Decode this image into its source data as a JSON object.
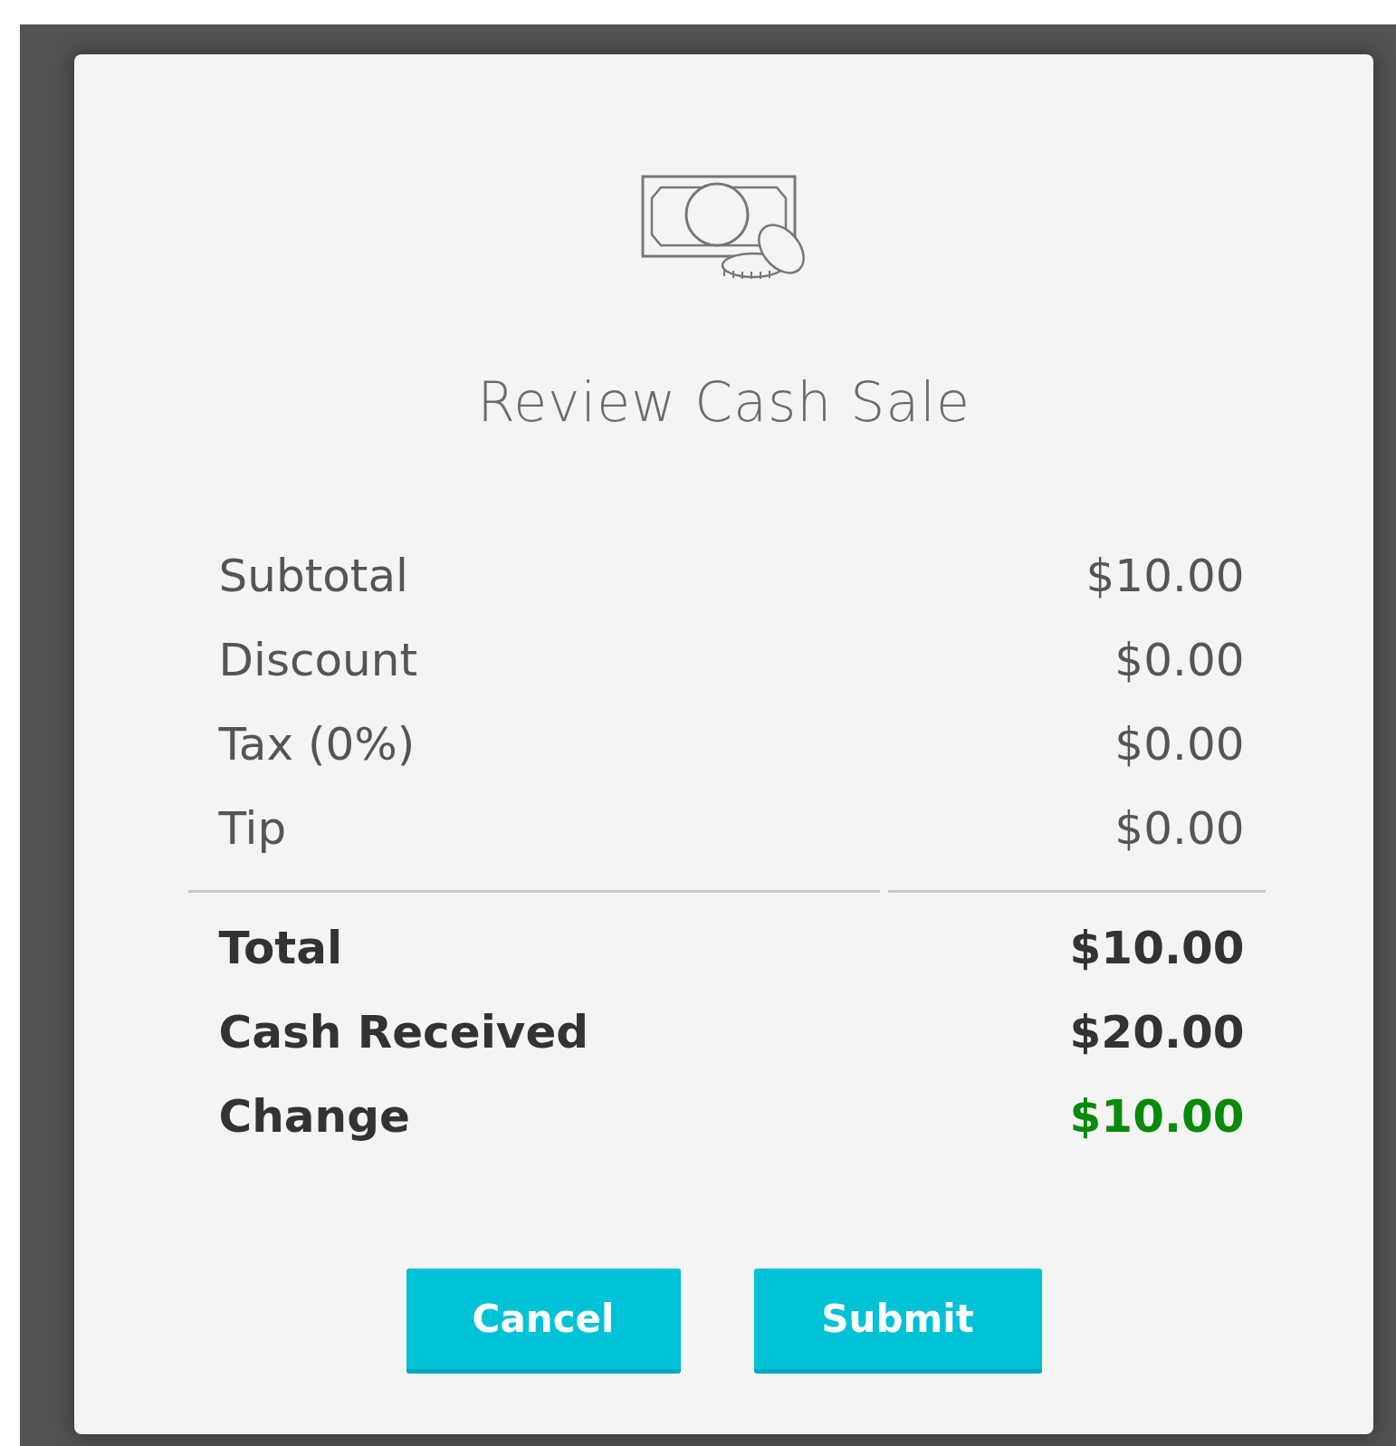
{
  "dialog": {
    "title": "Review Cash Sale",
    "lines": [
      {
        "label": "Subtotal",
        "amount": "$10.00",
        "kind": "item"
      },
      {
        "label": "Discount",
        "amount": "$0.00",
        "kind": "item"
      },
      {
        "label": "Tax (0%)",
        "amount": "$0.00",
        "kind": "item"
      },
      {
        "label": "Tip",
        "amount": "$0.00",
        "kind": "item"
      },
      {
        "label": "Total",
        "amount": "$10.00",
        "kind": "summary"
      },
      {
        "label": "Cash Received",
        "amount": "$20.00",
        "kind": "summary"
      },
      {
        "label": "Change",
        "amount": "$10.00",
        "kind": "summary",
        "color": "#0a8a0a"
      }
    ],
    "buttons": [
      "Cancel",
      "Submit"
    ]
  }
}
